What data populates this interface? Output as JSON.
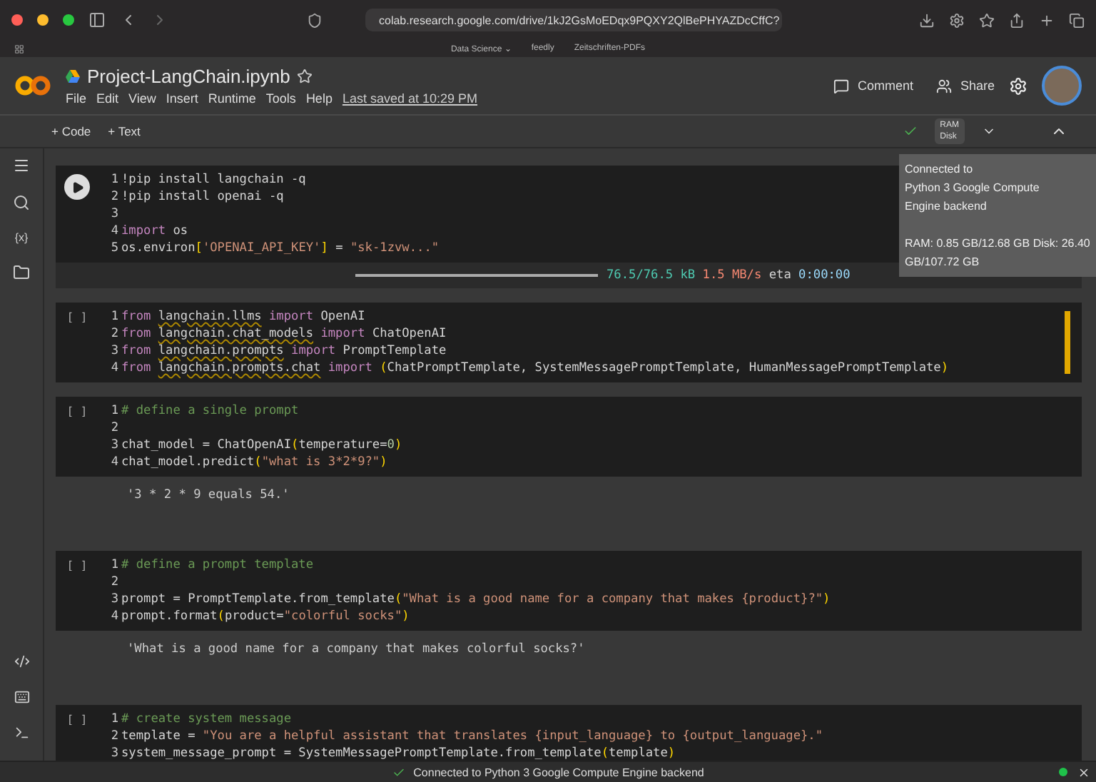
{
  "browser": {
    "url": "colab.research.google.com/drive/1kJ2GsMoEDqx9PQXY2QlBePHYAZDcCffC?",
    "bookmarks": [
      "Data Science ⌄",
      "feedly",
      "Zeitschriften-PDFs"
    ]
  },
  "header": {
    "title": "Project-LangChain.ipynb",
    "menu": [
      "File",
      "Edit",
      "View",
      "Insert",
      "Runtime",
      "Tools",
      "Help"
    ],
    "last_saved": "Last saved at 10:29 PM",
    "comment": "Comment",
    "share": "Share"
  },
  "toolbar": {
    "add_code": "+ Code",
    "add_text": "+ Text",
    "ram": "RAM",
    "disk": "Disk"
  },
  "sidebar": {
    "variables": "{x}"
  },
  "cells": [
    {
      "kind": "run",
      "lines": [
        {
          "number": "1",
          "tokens": [
            {
              "kind": "text",
              "text": "!pip install langchain -q"
            }
          ]
        },
        {
          "number": "2",
          "tokens": [
            {
              "kind": "text",
              "text": "!pip install openai -q"
            }
          ]
        },
        {
          "number": "3"
        },
        {
          "number": "4",
          "tokens": [
            {
              "kind": "kw",
              "text": "import "
            },
            {
              "kind": "text",
              "text": "os"
            }
          ]
        },
        {
          "number": "5",
          "tokens": [
            {
              "kind": "text",
              "text": "os.environ"
            },
            {
              "kind": "br",
              "text": "["
            },
            {
              "kind": "str",
              "text": "'OPENAI_API_KEY'"
            },
            {
              "kind": "br",
              "text": "]"
            },
            {
              "kind": "text",
              "text": " = "
            },
            {
              "kind": "str",
              "text": "\"sk-1zvw...\""
            }
          ]
        }
      ],
      "output": {
        "kind": "progress",
        "level": 1,
        "tokens": [
          {
            "kind": "ok",
            "text": "76.5/76.5 kB"
          },
          {
            "kind": "rate",
            "text": " 1.5 MB/s"
          },
          {
            "kind": "text",
            "text": " eta"
          },
          {
            "kind": "time",
            "text": " 0:00:00"
          }
        ]
      }
    },
    {
      "kind": "idle",
      "gutter": "[ ]",
      "lines": [
        {
          "number": "1",
          "tokens": [
            {
              "kind": "kw",
              "text": "from "
            },
            {
              "kind": "mod",
              "text": "langchain.llms"
            },
            {
              "kind": "kw",
              "text": " import "
            },
            {
              "kind": "text",
              "text": "OpenAI"
            }
          ]
        },
        {
          "number": "2",
          "tokens": [
            {
              "kind": "kw",
              "text": "from "
            },
            {
              "kind": "mod",
              "text": "langchain.chat_models"
            },
            {
              "kind": "kw",
              "text": " import "
            },
            {
              "kind": "text",
              "text": "ChatOpenAI"
            }
          ]
        },
        {
          "number": "3",
          "tokens": [
            {
              "kind": "kw",
              "text": "from "
            },
            {
              "kind": "mod",
              "text": "langchain.prompts"
            },
            {
              "kind": "kw",
              "text": " import "
            },
            {
              "kind": "text",
              "text": "PromptTemplate"
            }
          ]
        },
        {
          "number": "4",
          "tokens": [
            {
              "kind": "kw",
              "text": "from "
            },
            {
              "kind": "mod",
              "text": "langchain.prompts.chat"
            },
            {
              "kind": "kw",
              "text": " import "
            },
            {
              "kind": "br",
              "text": "("
            },
            {
              "kind": "text",
              "text": "ChatPromptTemplate, SystemMessagePromptTemplate, HumanMessagePromptTemplate"
            },
            {
              "kind": "br",
              "text": ")"
            }
          ]
        }
      ],
      "focused": true
    },
    {
      "kind": "idle",
      "gutter": "[ ]",
      "lines": [
        {
          "number": "1",
          "tokens": [
            {
              "kind": "com",
              "text": "# define a single prompt"
            }
          ]
        },
        {
          "number": "2"
        },
        {
          "number": "3",
          "tokens": [
            {
              "kind": "text",
              "text": "chat_model = ChatOpenAI"
            },
            {
              "kind": "br",
              "text": "("
            },
            {
              "kind": "text",
              "text": "temperature="
            },
            {
              "kind": "num",
              "text": "0"
            },
            {
              "kind": "br",
              "text": ")"
            }
          ]
        },
        {
          "number": "4",
          "tokens": [
            {
              "kind": "text",
              "text": "chat_model.predict"
            },
            {
              "kind": "br",
              "text": "("
            },
            {
              "kind": "str",
              "text": "\"what is 3*2*9?\""
            },
            {
              "kind": "br",
              "text": ")"
            }
          ]
        }
      ],
      "output": {
        "kind": "text",
        "text": "'3 * 2 * 9 equals 54.'"
      }
    },
    {
      "kind": "idle",
      "gutter": "[ ]",
      "lines": [
        {
          "number": "1",
          "tokens": [
            {
              "kind": "com",
              "text": "# define a prompt template"
            }
          ]
        },
        {
          "number": "2"
        },
        {
          "number": "3",
          "tokens": [
            {
              "kind": "text",
              "text": "prompt = PromptTemplate.from_template"
            },
            {
              "kind": "br",
              "text": "("
            },
            {
              "kind": "str",
              "text": "\"What is a good name for a company that makes {product}?\""
            },
            {
              "kind": "br",
              "text": ")"
            }
          ]
        },
        {
          "number": "4",
          "tokens": [
            {
              "kind": "text",
              "text": "prompt.format"
            },
            {
              "kind": "br",
              "text": "("
            },
            {
              "kind": "text",
              "text": "product="
            },
            {
              "kind": "str",
              "text": "\"colorful socks\""
            },
            {
              "kind": "br",
              "text": ")"
            }
          ]
        }
      ],
      "output": {
        "kind": "text",
        "text": "'What is a good name for a company that makes colorful socks?'"
      }
    },
    {
      "kind": "idle",
      "gutter": "[ ]",
      "lines": [
        {
          "number": "1",
          "tokens": [
            {
              "kind": "com",
              "text": "# create system message"
            }
          ]
        },
        {
          "number": "2",
          "tokens": [
            {
              "kind": "text",
              "text": "template = "
            },
            {
              "kind": "str",
              "text": "\"You are a helpful assistant that translates {input_language} to {output_language}.\""
            }
          ]
        },
        {
          "number": "3",
          "tokens": [
            {
              "kind": "text",
              "text": "system_message_prompt = SystemMessagePromptTemplate.from_template"
            },
            {
              "kind": "br",
              "text": "("
            },
            {
              "kind": "text",
              "text": "template"
            },
            {
              "kind": "br",
              "text": ")"
            }
          ]
        }
      ]
    }
  ],
  "tooltip": {
    "lines": [
      "Connected to",
      "Python 3 Google Compute",
      "Engine backend"
    ],
    "resources": "RAM: 0.85 GB/12.68 GB Disk: 26.40 GB/107.72 GB"
  },
  "status_bar": {
    "text": "Connected to Python 3 Google Compute Engine backend",
    "connected": true
  }
}
